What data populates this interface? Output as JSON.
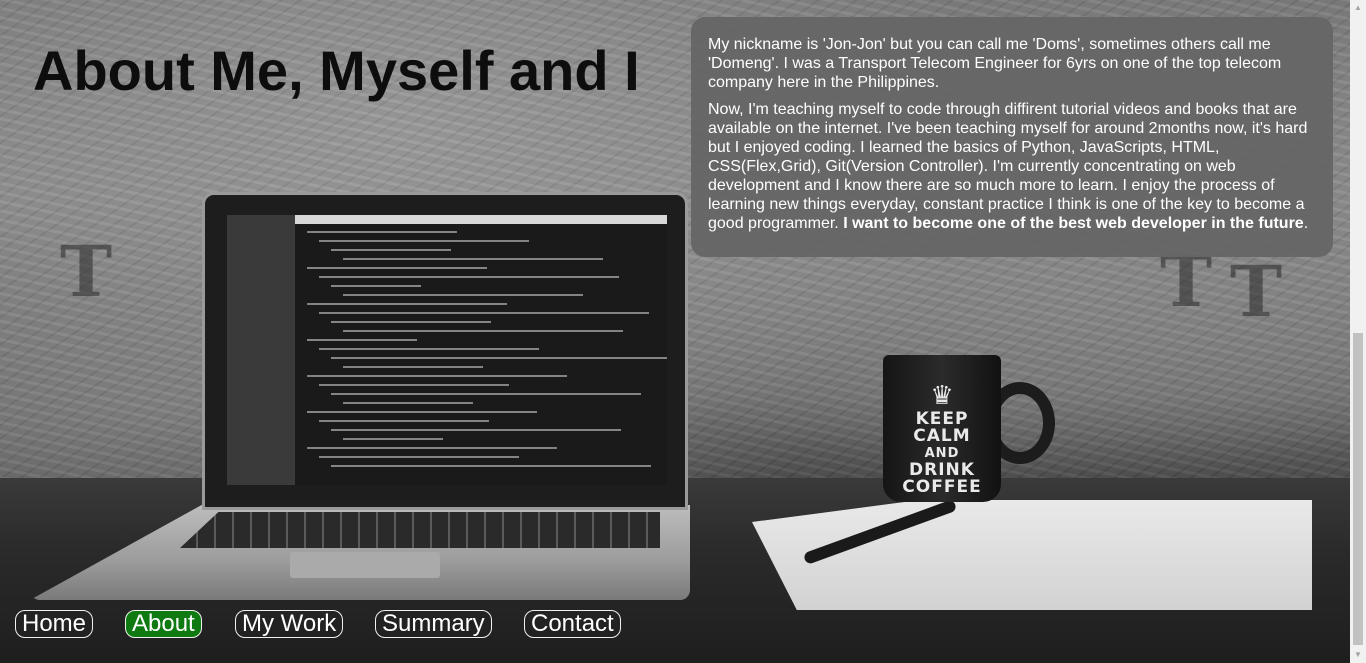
{
  "header": {
    "title": "About Me, Myself and I"
  },
  "about": {
    "paragraph1": "My nickname is 'Jon-Jon' but you can call me 'Doms', sometimes others call me 'Domeng'. I was a Transport Telecom Engineer for 6yrs on one of the top telecom company here in the Philippines.",
    "paragraph2": "Now, I'm teaching myself to code through diffirent tutorial videos and books that are available on the internet. I've been teaching myself for around 2months now, it's hard but I enjoyed coding. I learned the basics of Python, JavaScripts, HTML, CSS(Flex,Grid), Git(Version Controller). I'm currently concentrating on web development and I know there are so much more to learn. I enjoy the process of learning new things everyday, constant practice I think is one of the key to become a good programmer. ",
    "paragraph2_bold": "I want to become one of the best web developer in the future",
    "paragraph2_end": "."
  },
  "nav": {
    "items": [
      {
        "label": "Home",
        "active": false
      },
      {
        "label": "About",
        "active": true
      },
      {
        "label": "My Work",
        "active": false
      },
      {
        "label": "Summary",
        "active": false
      },
      {
        "label": "Contact",
        "active": false
      }
    ]
  },
  "background": {
    "mug_lines": [
      "KEEP",
      "CALM",
      "AND",
      "DRINK",
      "COFFEE"
    ]
  },
  "colors": {
    "active_nav": "#0f7a12",
    "panel": "#666666",
    "title": "#0d0d0d"
  }
}
